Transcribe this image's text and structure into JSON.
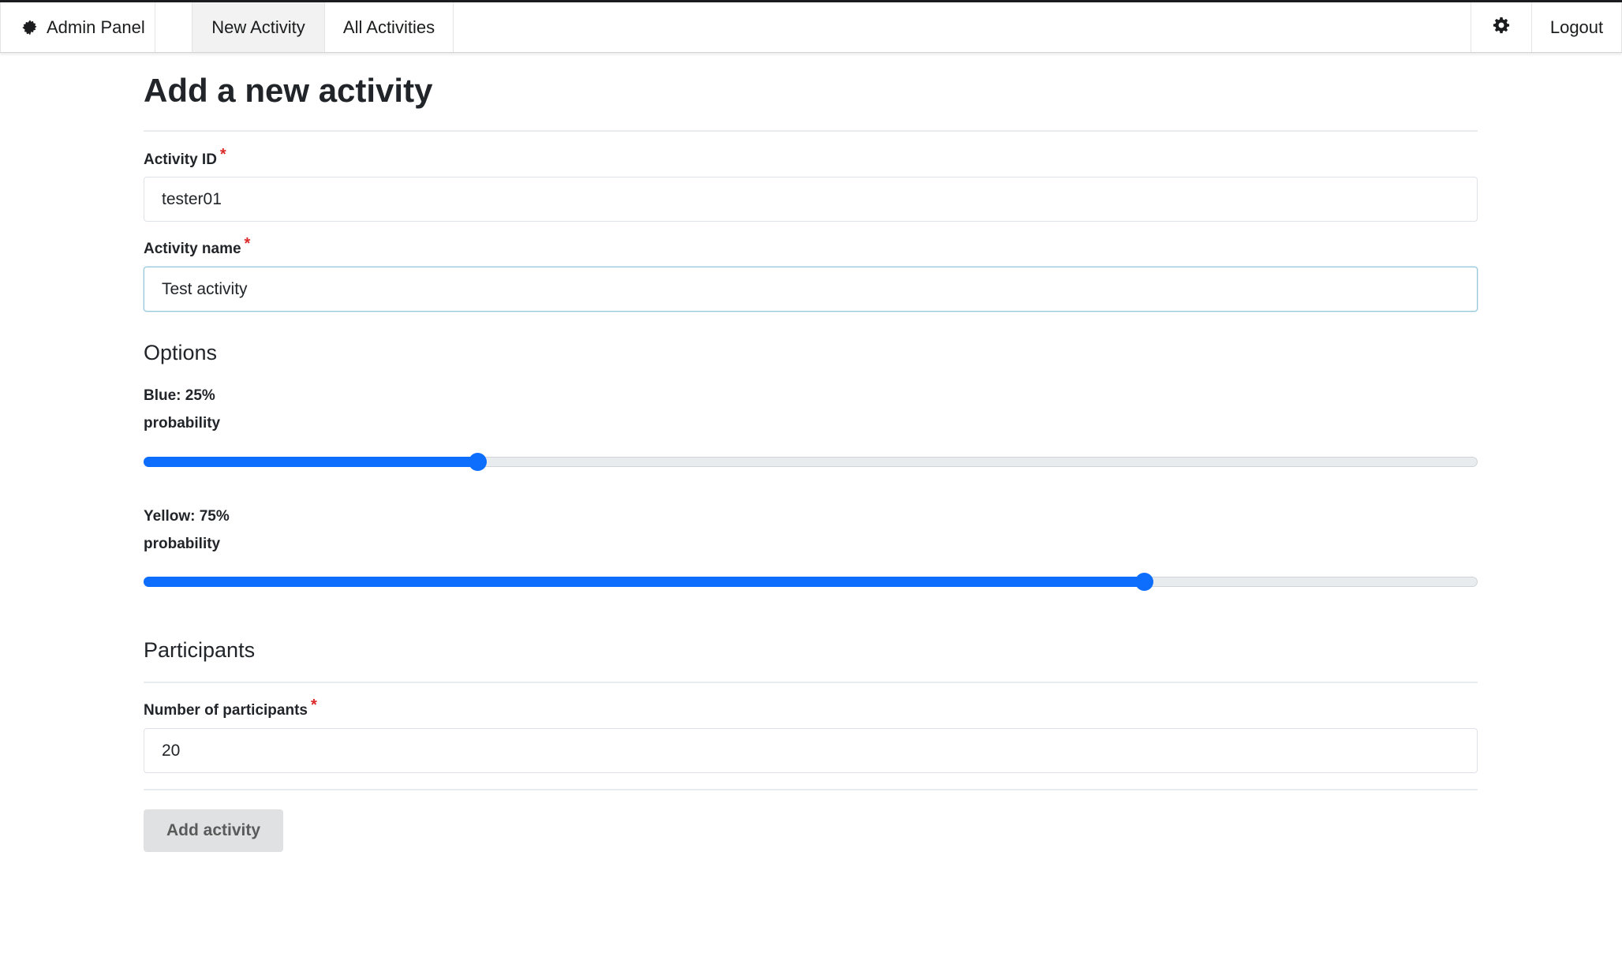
{
  "nav": {
    "brand": "Admin Panel",
    "tabs": [
      {
        "label": "New Activity",
        "active": true
      },
      {
        "label": "All Activities",
        "active": false
      }
    ],
    "settings_icon": "gear-icon",
    "logout": "Logout"
  },
  "page": {
    "title": "Add a new activity"
  },
  "form": {
    "activity_id": {
      "label": "Activity ID",
      "value": "tester01",
      "required_mark": "*"
    },
    "activity_name": {
      "label": "Activity name",
      "value": "Test activity",
      "required_mark": "*"
    }
  },
  "options": {
    "title": "Options",
    "sliders": [
      {
        "name": "Blue",
        "value_text": "Blue: 25% probability",
        "value": 0.25
      },
      {
        "name": "Yellow",
        "value_text": "Yellow: 75% probability",
        "value": 0.75
      }
    ]
  },
  "participants": {
    "title": "Participants",
    "count": {
      "label": "Number of participants",
      "value": "20",
      "required_mark": "*"
    }
  },
  "submit": {
    "label": "Add activity"
  },
  "colors": {
    "accent": "#0d6efd",
    "required": "#db2828",
    "button_bg": "#e0e1e2"
  }
}
